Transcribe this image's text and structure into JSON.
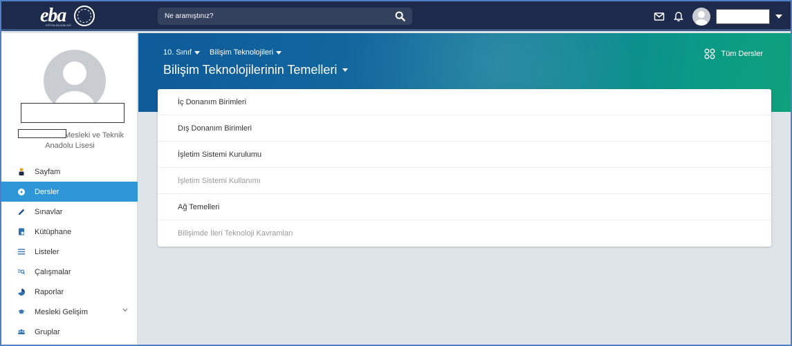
{
  "header": {
    "logo_text": "eba",
    "logo_subtext": "EĞİTİM BİLİŞİM AĞI",
    "search": {
      "placeholder": "Ne aramıştınız?"
    }
  },
  "sidebar": {
    "school_line1": "Mesleki ve Teknik",
    "school_line2": "Anadolu Lisesi",
    "items": [
      {
        "label": "Sayfam",
        "icon": "user-icon",
        "active": false
      },
      {
        "label": "Dersler",
        "icon": "play-circle-icon",
        "active": true
      },
      {
        "label": "Sınavlar",
        "icon": "pencil-icon",
        "active": false
      },
      {
        "label": "Kütüphane",
        "icon": "library-icon",
        "active": false
      },
      {
        "label": "Listeler",
        "icon": "list-icon",
        "active": false
      },
      {
        "label": "Çalışmalar",
        "icon": "search-list-icon",
        "active": false
      },
      {
        "label": "Raporlar",
        "icon": "pie-chart-icon",
        "active": false
      },
      {
        "label": "Mesleki Gelişim",
        "icon": "graduation-cap-icon",
        "active": false,
        "has_submenu": true
      },
      {
        "label": "Gruplar",
        "icon": "users-icon",
        "active": false
      }
    ]
  },
  "banner": {
    "grade": "10. Sınıf",
    "subject": "Bilişim Teknolojileri",
    "course_title": "Bilişim Teknolojilerinin Temelleri",
    "all_courses": "Tüm Dersler"
  },
  "units": [
    {
      "label": "İç Donanım Birimleri",
      "enabled": true
    },
    {
      "label": "Dış Donanım Birimleri",
      "enabled": true
    },
    {
      "label": "İşletim Sistemi Kurulumu",
      "enabled": true
    },
    {
      "label": "İşletim Sistemi Kullanımı",
      "enabled": false
    },
    {
      "label": "Ağ Temelleri",
      "enabled": true
    },
    {
      "label": "Bilişimde İleri Teknoloji Kavramları",
      "enabled": false
    }
  ],
  "colors": {
    "topbar": "#1d2a4c",
    "active_menu": "#2f97d7",
    "banner_start": "#0e5a9a",
    "banner_end": "#10a07c"
  }
}
